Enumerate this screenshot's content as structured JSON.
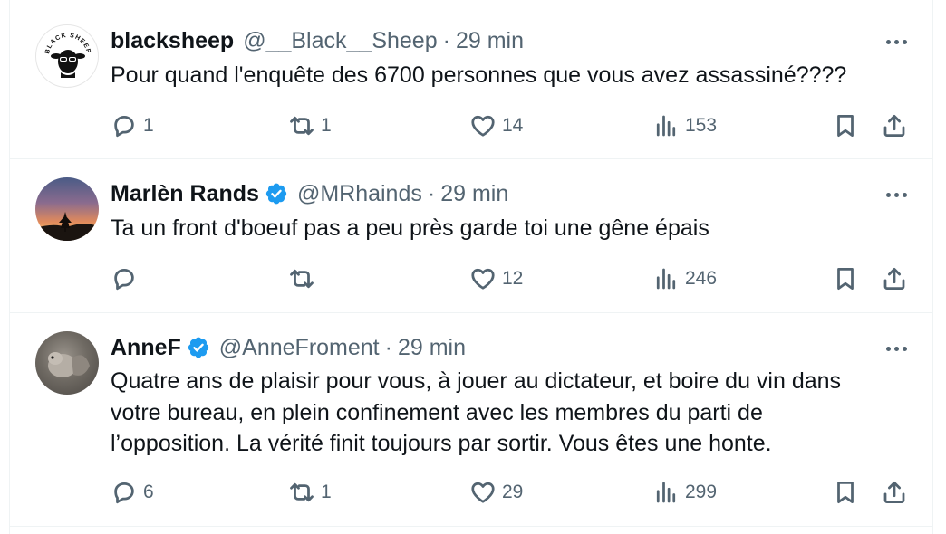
{
  "tweets": [
    {
      "name": "blacksheep",
      "verified": false,
      "handle": "@__Black__Sheep",
      "dot": "·",
      "time": "29 min",
      "text": "Pour quand l'enquête des 6700 personnes que vous avez assassiné????",
      "avatar_text": "BLACK SHEEP",
      "replies": "1",
      "reposts": "1",
      "likes": "14",
      "views": "153"
    },
    {
      "name": "Marlèn Rands",
      "verified": true,
      "handle": "@MRhainds",
      "dot": "·",
      "time": "29 min",
      "text": "Ta un front d'boeuf pas a peu près garde toi une gêne épais",
      "replies": "",
      "reposts": "",
      "likes": "12",
      "views": "246"
    },
    {
      "name": "AnneF",
      "verified": true,
      "handle": "@AnneFroment",
      "dot": "·",
      "time": "29 min",
      "text_lines": [
        "Quatre ans de plaisir pour vous, à jouer au dictateur, et boire du vin dans",
        "votre bureau, en plein confinement avec les membres du parti de",
        "l’opposition. La vérité finit toujours par sortir. Vous êtes une honte."
      ],
      "replies": "6",
      "reposts": "1",
      "likes": "29",
      "views": "299"
    }
  ],
  "icons": {
    "reply": "reply-icon",
    "repost": "repost-icon",
    "like": "like-icon",
    "views": "views-icon",
    "bookmark": "bookmark-icon",
    "share": "share-icon",
    "more": "more-icon",
    "verified": "verified-badge-icon"
  },
  "colors": {
    "text": "#0f1419",
    "secondary": "#536471",
    "verified": "#1d9bf0",
    "border": "#eff3f4"
  }
}
